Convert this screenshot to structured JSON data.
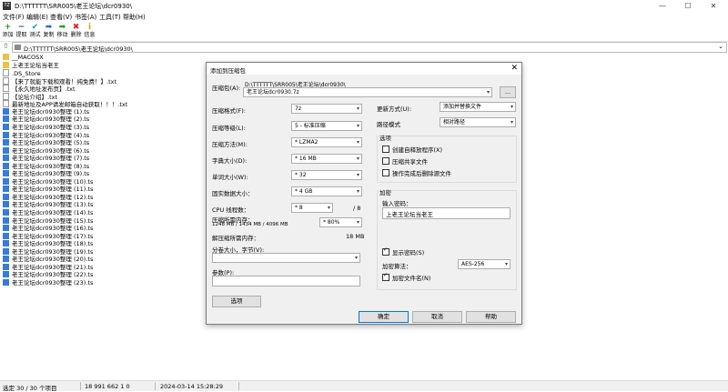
{
  "window": {
    "title": "D:\\TTTTTT\\SRR005\\老王论坛\\dcr0930\\",
    "app_icon": "7Z"
  },
  "menu": [
    "文件(F)",
    "编辑(E)",
    "查看(V)",
    "书签(A)",
    "工具(T)",
    "帮助(H)"
  ],
  "toolbar": [
    {
      "label": "添加",
      "icon": "plus-icon",
      "glyph": "+",
      "color": "#2a9a2a"
    },
    {
      "label": "提取",
      "icon": "minus-icon",
      "glyph": "−",
      "color": "#1f4fbf"
    },
    {
      "label": "测试",
      "icon": "check-icon",
      "glyph": "✔",
      "color": "#1f9f9f"
    },
    {
      "label": "复制",
      "icon": "copy-arrow-icon",
      "glyph": "➡",
      "color": "#2a6ad5"
    },
    {
      "label": "移动",
      "icon": "move-arrow-icon",
      "glyph": "➡",
      "color": "#2a9a2a"
    },
    {
      "label": "删除",
      "icon": "delete-icon",
      "glyph": "✖",
      "color": "#d22"
    },
    {
      "label": "信息",
      "icon": "info-icon",
      "glyph": "i",
      "color": "#d6a400"
    }
  ],
  "address": "D:\\TTTTTT\\SRR005\\老王论坛\\dcr0930\\",
  "files": [
    {
      "name": "__MACOSX",
      "type": "folder"
    },
    {
      "name": "上老王论坛当老王",
      "type": "folder"
    },
    {
      "name": ".DS_Store",
      "type": "file"
    },
    {
      "name": "【来了就能下载和观看！纯免费！】.txt",
      "type": "file"
    },
    {
      "name": "【永久地址发布页】.txt",
      "type": "file"
    },
    {
      "name": "【论坛介绍】.txt",
      "type": "file"
    },
    {
      "name": "最新地址及APP请发邮箱自动获取！！！.txt",
      "type": "file"
    },
    {
      "name": "老王论坛dcr0930整理 (1).ts",
      "type": "media"
    },
    {
      "name": "老王论坛dcr0930整理 (2).ts",
      "type": "media"
    },
    {
      "name": "老王论坛dcr0930整理 (3).ts",
      "type": "media"
    },
    {
      "name": "老王论坛dcr0930整理 (4).ts",
      "type": "media"
    },
    {
      "name": "老王论坛dcr0930整理 (5).ts",
      "type": "media"
    },
    {
      "name": "老王论坛dcr0930整理 (6).ts",
      "type": "media"
    },
    {
      "name": "老王论坛dcr0930整理 (7).ts",
      "type": "media"
    },
    {
      "name": "老王论坛dcr0930整理 (8).ts",
      "type": "media"
    },
    {
      "name": "老王论坛dcr0930整理 (9).ts",
      "type": "media"
    },
    {
      "name": "老王论坛dcr0930整理 (10).ts",
      "type": "media"
    },
    {
      "name": "老王论坛dcr0930整理 (11).ts",
      "type": "media"
    },
    {
      "name": "老王论坛dcr0930整理 (12).ts",
      "type": "media"
    },
    {
      "name": "老王论坛dcr0930整理 (13).ts",
      "type": "media"
    },
    {
      "name": "老王论坛dcr0930整理 (14).ts",
      "type": "media"
    },
    {
      "name": "老王论坛dcr0930整理 (15).ts",
      "type": "media"
    },
    {
      "name": "老王论坛dcr0930整理 (16).ts",
      "type": "media"
    },
    {
      "name": "老王论坛dcr0930整理 (17).ts",
      "type": "media"
    },
    {
      "name": "老王论坛dcr0930整理 (18).ts",
      "type": "media"
    },
    {
      "name": "老王论坛dcr0930整理 (19).ts",
      "type": "media"
    },
    {
      "name": "老王论坛dcr0930整理 (20).ts",
      "type": "media"
    },
    {
      "name": "老王论坛dcr0930整理 (21).ts",
      "type": "media"
    },
    {
      "name": "老王论坛dcr0930整理 (22).ts",
      "type": "media"
    },
    {
      "name": "老王论坛dcr0930整理 (23).ts",
      "type": "media"
    }
  ],
  "status": {
    "selection": "选定 30 / 30 个项目",
    "size": "18 991 662 1 0",
    "date": "2024-03-14 15:28:29"
  },
  "dialog": {
    "title": "添加到压缩包",
    "archive_label": "压缩包(A):",
    "archive_path": "D:\\TTTTTT\\SRR005\\老王论坛\\dcr0930\\",
    "archive_name": "老王论坛dcr0930.7z",
    "browse": "...",
    "format_label": "压缩格式(F):",
    "format_value": "7z",
    "level_label": "压缩等级(L):",
    "level_value": "5 - 标准压缩",
    "method_label": "压缩方法(M):",
    "method_value": "* LZMA2",
    "dict_label": "字典大小(D):",
    "dict_value": "* 16 MB",
    "word_label": "单词大小(W):",
    "word_value": "* 32",
    "solid_label": "固实数据大小：",
    "solid_value": "* 4 GB",
    "cpu_label": "CPU 线程数：",
    "cpu_value": "* 8",
    "cpu_max": "/ 8",
    "mem_label": "压缩所需内存：",
    "mem_detail": "1248 MB / 1434 MB / 4096 MB",
    "mem_value": "* 80%",
    "decomp_label": "解压缩所需内存：",
    "decomp_value": "18 MB",
    "split_label": "分卷大小，字节(V):",
    "params_label": "参数(P):",
    "options_btn": "选项",
    "update_label": "更新方式(U):",
    "update_value": "添加并替换文件",
    "path_label": "路径模式",
    "path_value": "相对路径",
    "opts_group": "选项",
    "opts": [
      {
        "label": "创建自释放程序(X)",
        "checked": false
      },
      {
        "label": "压缩共享文件",
        "checked": false
      },
      {
        "label": "操作完成后删除源文件",
        "checked": false
      }
    ],
    "enc_group": "加密",
    "pwd_label": "输入密码：",
    "pwd_value": "上老王论坛当老王",
    "show_pwd": "显示密码(S)",
    "show_pwd_checked": true,
    "enc_method_label": "加密算法：",
    "enc_method_value": "AES-256",
    "enc_names": "加密文件名(N)",
    "enc_names_checked": true,
    "ok": "确定",
    "cancel": "取消",
    "help": "帮助"
  }
}
